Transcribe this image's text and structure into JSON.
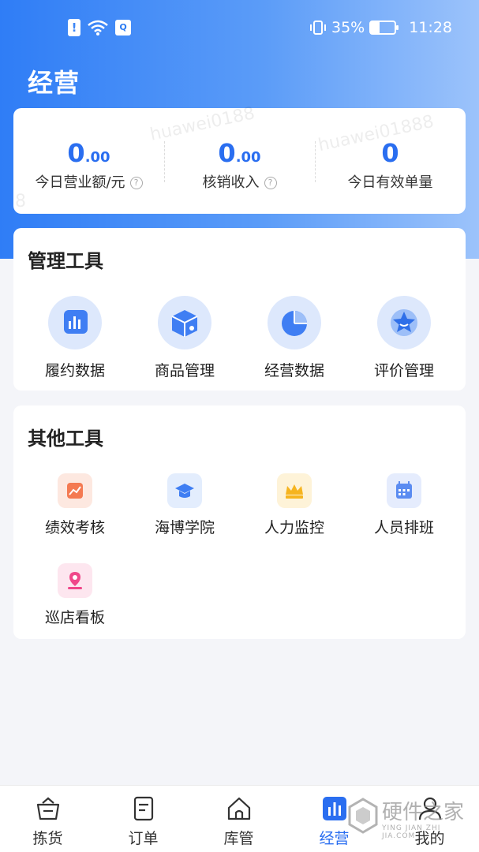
{
  "status_bar": {
    "battery": "35%",
    "battery_level": 0.35,
    "time": "11:28"
  },
  "header": {
    "title": "经营"
  },
  "stats": [
    {
      "int": "0",
      "dec": ".00",
      "label": "今日营业额/元",
      "help": "?"
    },
    {
      "int": "0",
      "dec": ".00",
      "label": "核销收入",
      "help": "?"
    },
    {
      "int": "0",
      "dec": "",
      "label": "今日有效单量"
    }
  ],
  "watermarks": [
    "huawei0188",
    "huawei01888",
    "8"
  ],
  "management_tools": {
    "title": "管理工具",
    "items": [
      {
        "label": "履约数据",
        "icon": "bar-chart-icon"
      },
      {
        "label": "商品管理",
        "icon": "product-box-icon"
      },
      {
        "label": "经营数据",
        "icon": "pie-chart-icon"
      },
      {
        "label": "评价管理",
        "icon": "star-badge-icon"
      }
    ]
  },
  "other_tools": {
    "title": "其他工具",
    "items": [
      {
        "label": "绩效考核",
        "icon": "performance-chart-icon",
        "color": "#fde8e0"
      },
      {
        "label": "海博学院",
        "icon": "graduation-cap-icon",
        "color": "#e3edfd"
      },
      {
        "label": "人力监控",
        "icon": "crown-icon",
        "color": "#fef3d8"
      },
      {
        "label": "人员排班",
        "icon": "calendar-icon",
        "color": "#e5ecfd"
      },
      {
        "label": "巡店看板",
        "icon": "location-pin-icon",
        "color": "#fde6ef"
      }
    ]
  },
  "tabbar": {
    "items": [
      {
        "label": "拣货",
        "icon": "basket-icon",
        "active": false
      },
      {
        "label": "订单",
        "icon": "order-list-icon",
        "active": false
      },
      {
        "label": "库管",
        "icon": "home-icon",
        "active": false
      },
      {
        "label": "经营",
        "icon": "business-chart-icon",
        "active": true
      },
      {
        "label": "我的",
        "icon": "user-icon",
        "active": false
      }
    ]
  },
  "brand_watermark": {
    "text": "硬件之家",
    "sub": "YING JIAN ZHI JIA.COM"
  },
  "colors": {
    "accent": "#2a6ef0",
    "hero_start": "#2f7df6",
    "hero_end": "#9cc3fb"
  }
}
